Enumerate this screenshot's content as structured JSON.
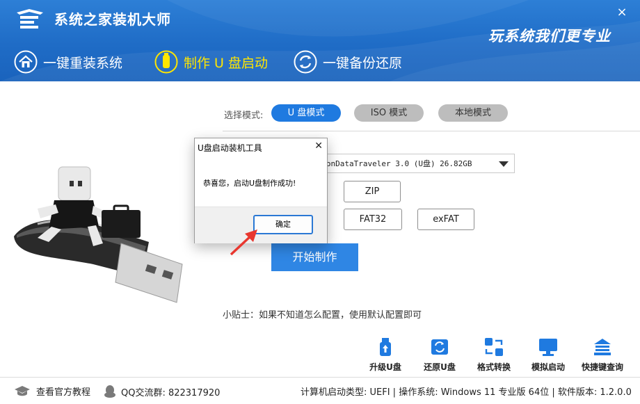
{
  "app": {
    "title": "系统之家装机大师",
    "slogan": "玩系统我们更专业",
    "close_glyph": "×"
  },
  "nav": [
    {
      "label": "一键重装系统",
      "icon": "house-icon",
      "active": false
    },
    {
      "label": "制作 U 盘启动",
      "icon": "usb-drive-icon",
      "active": true
    },
    {
      "label": "一键备份还原",
      "icon": "backup-restore-icon",
      "active": false
    }
  ],
  "mode": {
    "label": "选择模式:",
    "options": [
      {
        "label": "U 盘模式",
        "selected": true
      },
      {
        "label": "ISO 模式",
        "selected": false
      },
      {
        "label": "本地模式",
        "selected": false
      }
    ]
  },
  "device_select": {
    "value": "gstonDataTraveler 3.0 (U盘) 26.82GB"
  },
  "formats": {
    "row1": [
      "ZIP"
    ],
    "row2": [
      "FAT32",
      "exFAT"
    ]
  },
  "start_button": "开始制作",
  "tip": "小贴士：如果不知道怎么配置，使用默认配置即可",
  "tools": [
    {
      "label": "升级U盘",
      "icon": "usb-upgrade-icon"
    },
    {
      "label": "还原U盘",
      "icon": "usb-restore-icon"
    },
    {
      "label": "格式转换",
      "icon": "format-convert-icon"
    },
    {
      "label": "模拟启动",
      "icon": "monitor-icon"
    },
    {
      "label": "快捷键查询",
      "icon": "keyboard-shortcut-icon"
    }
  ],
  "statusbar": {
    "tutorial": "查看官方教程",
    "qq_group": "QQ交流群: 822317920",
    "info": "计算机启动类型: UEFI | 操作系统: Windows 11 专业版 64位 | 软件版本: 1.2.0.0"
  },
  "dialog": {
    "title": "U盘启动装机工具",
    "close_glyph": "✕",
    "message": "恭喜您，启动U盘制作成功!",
    "ok_label": "确定"
  },
  "colors": {
    "header_blue": "#1f6cc6",
    "accent_blue": "#1f7ae0",
    "active_yellow": "#ffe600",
    "annotation_red": "#e8372f"
  }
}
